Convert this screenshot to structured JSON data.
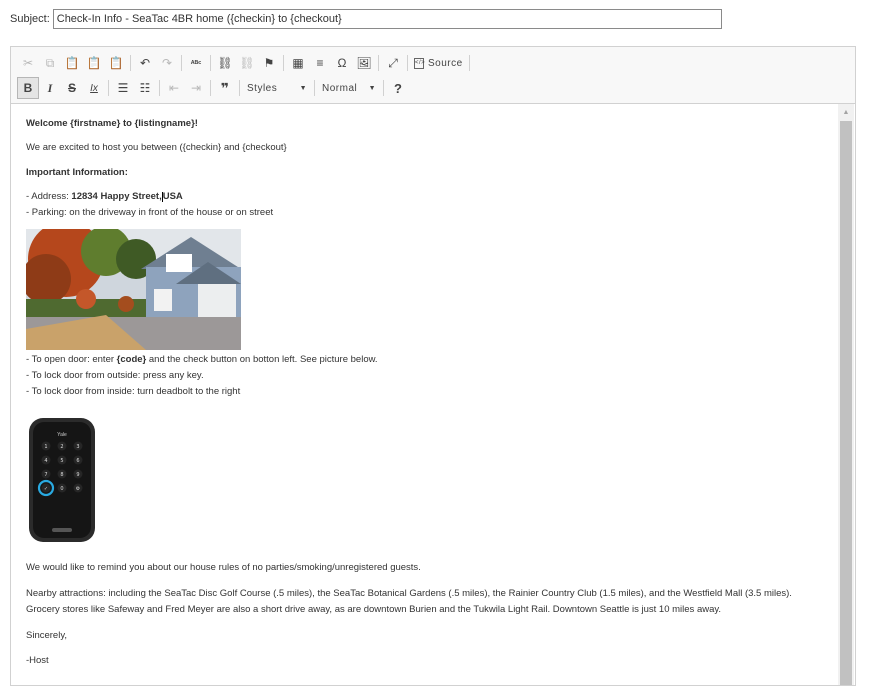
{
  "subject": {
    "label": "Subject:",
    "value": "Check-In Info - SeaTac 4BR home ({checkin} to {checkout}"
  },
  "toolbar": {
    "source_label": "Source",
    "styles_label": "Styles",
    "format_label": "Normal",
    "help_glyph": "?",
    "bold_glyph": "B",
    "italic_glyph": "I",
    "strike_glyph": "S",
    "removeformat_glyph": "Ix",
    "quote_glyph": "❞"
  },
  "content": {
    "greeting_prefix": "Welcome {firstname} to {listingname}!",
    "excited": "We are excited to host you between ({checkin} and {checkout}",
    "important": "Important Information:",
    "address_prefix": "- Address: ",
    "address_bold": "12834 Happy Street,",
    "address_bold2": "USA",
    "parking": "- Parking: on the driveway in front of the house or on street",
    "open_door_prefix": "- To open door: enter ",
    "open_door_code": "{code}",
    "open_door_suffix": " and the check button on botton left. See picture below.",
    "lock_outside": "- To lock door from outside: press any key.",
    "lock_inside": "- To lock door from inside: turn deadbolt to the right",
    "lock_brand": "Yale",
    "keypad": [
      "1",
      "2",
      "3",
      "4",
      "5",
      "6",
      "7",
      "8",
      "9",
      "✓",
      "0",
      "⚙"
    ],
    "remind": "We would like to remind you about our house rules of no parties/smoking/unregistered guests.",
    "nearby": "Nearby attractions: including the SeaTac Disc Golf Course (.5 miles), the SeaTac Botanical Gardens (.5 miles), the Rainier Country Club (1.5 miles), and the Westfield Mall (3.5 miles).",
    "grocery": "Grocery stores like Safeway and Fred Meyer are also a short drive away, as are downtown Burien and the Tukwila Light Rail. Downtown Seattle is just 10 miles away.",
    "sincerely": "Sincerely,",
    "host": "-Host"
  },
  "colors": {
    "toolbar_bg": "#f8f8f8",
    "border": "#d1d1d1",
    "scroll_thumb": "#c1c1c1",
    "lock_ring": "#29a9e0"
  }
}
